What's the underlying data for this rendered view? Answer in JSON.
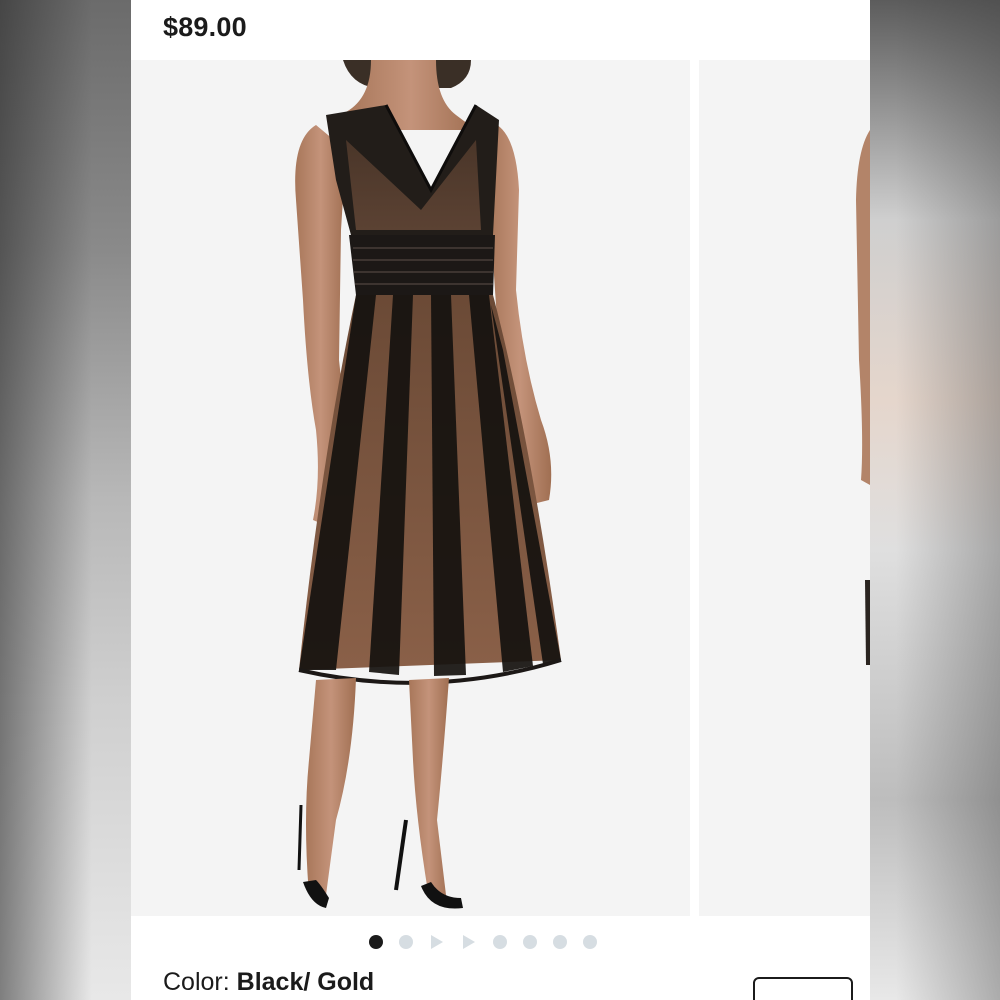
{
  "product": {
    "price": "$89.00",
    "color_label": "Color:",
    "color_value": "Black/ Gold"
  },
  "gallery": {
    "main_image": "model-in-black-gold-midi-dress",
    "next_image": "model-side-view-partial",
    "indicators": [
      {
        "kind": "dot",
        "active": true
      },
      {
        "kind": "dot",
        "active": false
      },
      {
        "kind": "play",
        "active": false
      },
      {
        "kind": "play",
        "active": false
      },
      {
        "kind": "dot",
        "active": false
      },
      {
        "kind": "dot",
        "active": false
      },
      {
        "kind": "dot",
        "active": false
      },
      {
        "kind": "dot",
        "active": false
      }
    ],
    "colors": {
      "active_dot": "#1b1b1b",
      "inactive_dot": "#d6dde2",
      "photo_bg": "#f4f4f4"
    }
  }
}
